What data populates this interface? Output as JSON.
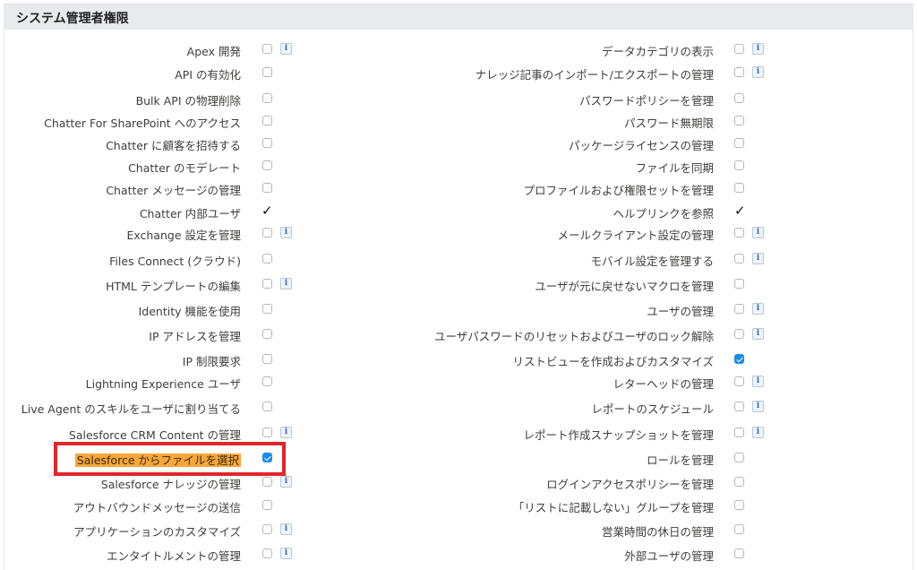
{
  "section": {
    "title": "システム管理者権限"
  },
  "colors": {
    "highlight": "#f7a73a",
    "annotation_border": "#e0262c",
    "checkbox_checked": "#1a8cf0"
  },
  "left": [
    {
      "label": "Apex 開発",
      "state": "unchecked",
      "info": true
    },
    {
      "label": "API の有効化",
      "state": "unchecked",
      "info": false
    },
    {
      "label": "Bulk API の物理削除",
      "state": "unchecked",
      "info": false
    },
    {
      "label": "Chatter For SharePoint へのアクセス",
      "state": "unchecked",
      "info": false
    },
    {
      "label": "Chatter に顧客を招待する",
      "state": "unchecked",
      "info": false
    },
    {
      "label": "Chatter のモデレート",
      "state": "unchecked",
      "info": false
    },
    {
      "label": "Chatter メッセージの管理",
      "state": "unchecked",
      "info": false
    },
    {
      "label": "Chatter 内部ユーザ",
      "state": "tick",
      "info": false
    },
    {
      "label": "Exchange 設定を管理",
      "state": "unchecked",
      "info": true
    },
    {
      "label": "Files Connect (クラウド)",
      "state": "unchecked",
      "info": false
    },
    {
      "label": "HTML テンプレートの編集",
      "state": "unchecked",
      "info": true
    },
    {
      "label": "Identity 機能を使用",
      "state": "unchecked",
      "info": false
    },
    {
      "label": "IP アドレスを管理",
      "state": "unchecked",
      "info": false
    },
    {
      "label": "IP 制限要求",
      "state": "unchecked",
      "info": false
    },
    {
      "label": "Lightning Experience ユーザ",
      "state": "unchecked",
      "info": false
    },
    {
      "label": "Live Agent のスキルをユーザに割り当てる",
      "state": "unchecked",
      "info": false
    },
    {
      "label": "Salesforce CRM Content の管理",
      "state": "unchecked",
      "info": true
    },
    {
      "label": "Salesforce からファイルを選択",
      "state": "checked",
      "info": false,
      "highlight": true
    },
    {
      "label": "Salesforce ナレッジの管理",
      "state": "unchecked",
      "info": true
    },
    {
      "label": "アウトバウンドメッセージの送信",
      "state": "unchecked",
      "info": false
    },
    {
      "label": "アプリケーションのカスタマイズ",
      "state": "unchecked",
      "info": true
    },
    {
      "label": "エンタイトルメントの管理",
      "state": "unchecked",
      "info": true
    }
  ],
  "right": [
    {
      "label": "データカテゴリの表示",
      "state": "unchecked",
      "info": true
    },
    {
      "label": "ナレッジ記事のインポート/エクスポートの管理",
      "state": "unchecked",
      "info": true
    },
    {
      "label": "パスワードポリシーを管理",
      "state": "unchecked",
      "info": false
    },
    {
      "label": "パスワード無期限",
      "state": "unchecked",
      "info": false
    },
    {
      "label": "パッケージライセンスの管理",
      "state": "unchecked",
      "info": false
    },
    {
      "label": "ファイルを同期",
      "state": "unchecked",
      "info": false
    },
    {
      "label": "プロファイルおよび権限セットを管理",
      "state": "unchecked",
      "info": false
    },
    {
      "label": "ヘルプリンクを参照",
      "state": "tick",
      "info": false
    },
    {
      "label": "メールクライアント設定の管理",
      "state": "unchecked",
      "info": true
    },
    {
      "label": "モバイル設定を管理する",
      "state": "unchecked",
      "info": true
    },
    {
      "label": "ユーザが元に戻せないマクロを管理",
      "state": "unchecked",
      "info": false
    },
    {
      "label": "ユーザの管理",
      "state": "unchecked",
      "info": true
    },
    {
      "label": "ユーザパスワードのリセットおよびユーザのロック解除",
      "state": "unchecked",
      "info": true
    },
    {
      "label": "リストビューを作成およびカスタマイズ",
      "state": "checked",
      "info": false
    },
    {
      "label": "レターヘッドの管理",
      "state": "unchecked",
      "info": true
    },
    {
      "label": "レポートのスケジュール",
      "state": "unchecked",
      "info": true
    },
    {
      "label": "レポート作成スナップショットを管理",
      "state": "unchecked",
      "info": true
    },
    {
      "label": "ロールを管理",
      "state": "unchecked",
      "info": false
    },
    {
      "label": "ログインアクセスポリシーを管理",
      "state": "unchecked",
      "info": false
    },
    {
      "label": "「リストに記載しない」グループを管理",
      "state": "unchecked",
      "info": false
    },
    {
      "label": "営業時間の休日の管理",
      "state": "unchecked",
      "info": false
    },
    {
      "label": "外部ユーザの管理",
      "state": "unchecked",
      "info": false
    }
  ]
}
